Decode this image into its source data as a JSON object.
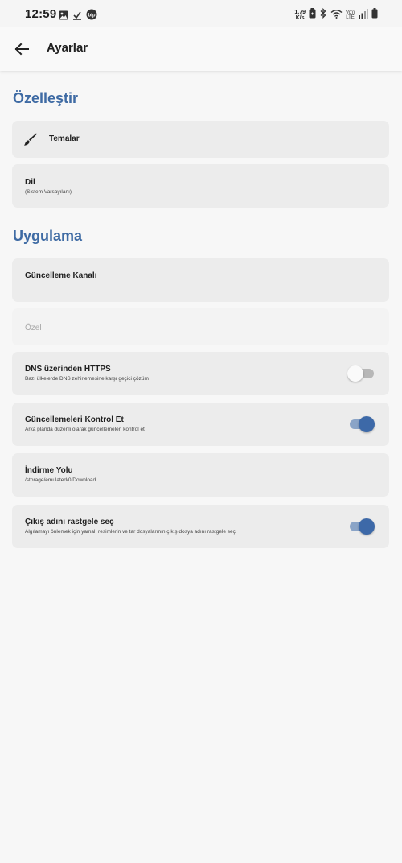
{
  "status_bar": {
    "time": "12:59",
    "left_icons": [
      "gallery-icon",
      "download-done-icon",
      "bip-app-icon"
    ],
    "bip_label": "bip",
    "net_speed_value": "1,79",
    "net_speed_unit": "K/s",
    "volte_top": "Vo))",
    "volte_bottom": "LTE",
    "right_icons": [
      "battery-saver-icon",
      "bluetooth-icon",
      "wifi-icon",
      "volte-icon",
      "signal-icon",
      "battery-icon"
    ]
  },
  "app_bar": {
    "back_icon": "arrow-left-icon",
    "title": "Ayarlar"
  },
  "sections": {
    "customize": {
      "title": "Özelleştir",
      "themes": {
        "icon": "paint-brush-icon",
        "label": "Temalar"
      },
      "language": {
        "label": "Dil",
        "value": "(Sistem Varsayılanı)"
      }
    },
    "application": {
      "title": "Uygulama",
      "update_channel": {
        "label": "Güncelleme Kanalı"
      },
      "custom": {
        "label": "Özel"
      },
      "dns_https": {
        "label": "DNS üzerinden HTTPS",
        "description": "Bazı ülkelerde DNS zehirlemesine karşı geçici çözüm",
        "enabled": false
      },
      "check_updates": {
        "label": "Güncellemeleri Kontrol Et",
        "description": "Arka planda düzenli olarak güncellemeleri kontrol et",
        "enabled": true
      },
      "download_path": {
        "label": "İndirme Yolu",
        "value": "/storage/emulated/0/Download"
      },
      "random_output": {
        "label": "Çıkış adını rastgele seç",
        "description": "Algılamayı önlemek için yamalı resimlerin ve tar dosyalarının çıkış dosya adını rastgele seç",
        "enabled": true
      }
    }
  },
  "colors": {
    "accent": "#3f6ba4",
    "toggle_on_thumb": "#3d69a8",
    "toggle_on_track": "#8aa4c7",
    "card_background": "#ececec",
    "page_background": "#f7f7f7"
  }
}
